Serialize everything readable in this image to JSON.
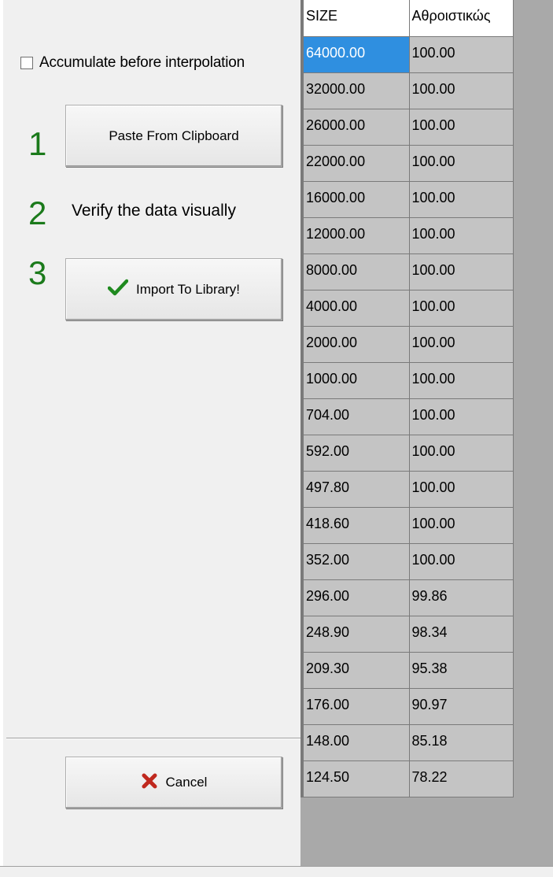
{
  "options": {
    "accumulate_label": "Accumulate before interpolation",
    "accumulate_checked": false
  },
  "steps": [
    {
      "number": "1",
      "button_label": "Paste From Clipboard"
    },
    {
      "number": "2",
      "text": "Verify the data visually"
    },
    {
      "number": "3",
      "button_label": "Import To Library!"
    }
  ],
  "cancel_label": "Cancel",
  "icons": {
    "import": "checkmark-icon",
    "cancel": "x-icon"
  },
  "colors": {
    "step_number": "#1b7a1b",
    "selected_cell": "#2f8fe0",
    "cell_bg": "#c4c4c4"
  },
  "grid": {
    "headers": [
      "SIZE",
      "Αθροιστικώς"
    ],
    "rows": [
      [
        "64000.00",
        "100.00"
      ],
      [
        "32000.00",
        "100.00"
      ],
      [
        "26000.00",
        "100.00"
      ],
      [
        "22000.00",
        "100.00"
      ],
      [
        "16000.00",
        "100.00"
      ],
      [
        "12000.00",
        "100.00"
      ],
      [
        "8000.00",
        "100.00"
      ],
      [
        "4000.00",
        "100.00"
      ],
      [
        "2000.00",
        "100.00"
      ],
      [
        "1000.00",
        "100.00"
      ],
      [
        "704.00",
        "100.00"
      ],
      [
        "592.00",
        "100.00"
      ],
      [
        "497.80",
        "100.00"
      ],
      [
        "418.60",
        "100.00"
      ],
      [
        "352.00",
        "100.00"
      ],
      [
        "296.00",
        "99.86"
      ],
      [
        "248.90",
        "98.34"
      ],
      [
        "209.30",
        "95.38"
      ],
      [
        "176.00",
        "90.97"
      ],
      [
        "148.00",
        "85.18"
      ],
      [
        "124.50",
        "78.22"
      ]
    ]
  }
}
